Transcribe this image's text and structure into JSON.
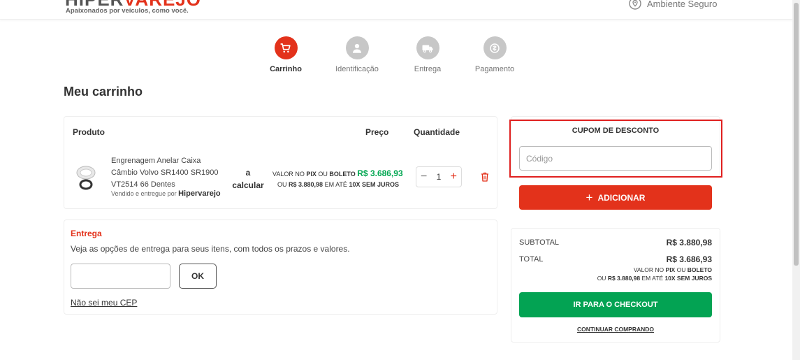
{
  "header": {
    "logo_dark": "HIPER",
    "logo_red": "VAREJO",
    "tagline": "Apaixonados por veículos, como você.",
    "secure_label": "Ambiente Seguro"
  },
  "steps": [
    {
      "label": "Carrinho",
      "icon": "cart-icon",
      "active": true
    },
    {
      "label": "Identificação",
      "icon": "user-icon",
      "active": false
    },
    {
      "label": "Entrega",
      "icon": "truck-icon",
      "active": false
    },
    {
      "label": "Pagamento",
      "icon": "payment-icon",
      "active": false
    }
  ],
  "page_title": "Meu carrinho",
  "cart": {
    "headers": {
      "product": "Produto",
      "price": "Preço",
      "quantity": "Quantidade"
    },
    "item": {
      "name": "Engrenagem Anelar Caixa Câmbio Volvo SR1400 SR1900 VT2514 66 Dentes",
      "seller_prefix": "Vendido e entregue por",
      "seller": "Hipervarejo",
      "shipping": "a calcular",
      "pix_prefix": "VALOR NO",
      "pix_word": "PIX",
      "or_word": "OU",
      "boleto_word": "BOLETO",
      "pix_price": "R$ 3.686,93",
      "installment_prefix": "OU",
      "installment_total": "R$ 3.880,98",
      "installment_mid": "EM ATÉ",
      "installment_terms": "10X SEM JUROS",
      "quantity": "1",
      "minus": "−",
      "plus": "+"
    }
  },
  "delivery": {
    "title": "Entrega",
    "description": "Veja as opções de entrega para seus itens, com todos os prazos e valores.",
    "cep_value": "",
    "ok_label": "OK",
    "unknown_cep_link": "Não sei meu CEP"
  },
  "coupon": {
    "title": "CUPOM DE DESCONTO",
    "placeholder": "Código",
    "add_label": "ADICIONAR",
    "add_icon": "+"
  },
  "summary": {
    "subtotal_label": "SUBTOTAL",
    "subtotal_value": "R$ 3.880,98",
    "total_label": "TOTAL",
    "total_value": "R$ 3.686,93",
    "pix_prefix": "VALOR NO",
    "pix_word": "PIX",
    "or_word": "OU",
    "boleto_word": "BOLETO",
    "installment_prefix": "OU",
    "installment_total": "R$ 3.880,98",
    "installment_mid": "EM ATÉ",
    "installment_terms": "10X SEM JUROS",
    "checkout_label": "IR PARA O CHECKOUT",
    "continue_label": "CONTINUAR COMPRANDO"
  },
  "colors": {
    "brand_red": "#e3321b",
    "checkout_green": "#03a353",
    "highlight_red": "#e0201f",
    "price_green": "#00a650"
  }
}
